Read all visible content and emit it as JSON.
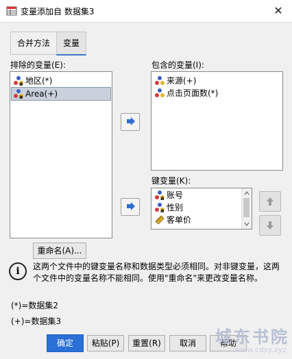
{
  "window": {
    "title": "变量添加自 数据集3",
    "close_glyph": "✕"
  },
  "tabs": [
    {
      "label": "合并方法",
      "active": false
    },
    {
      "label": "变量",
      "active": true
    }
  ],
  "excluded": {
    "label": "排除的变量(E):",
    "items": [
      {
        "label": "地区(*)",
        "icon": "nominal-variable-icon",
        "selected": false
      },
      {
        "label": "Area(+)",
        "icon": "nominal-variable-icon",
        "selected": true
      }
    ]
  },
  "included": {
    "label": "包含的变量(I):",
    "items": [
      {
        "label": "来源(+)",
        "icon": "nominal-variable-icon"
      },
      {
        "label": "点击页面数(*)",
        "icon": "scale-variable-icon"
      }
    ]
  },
  "key": {
    "label": "键变量(K):",
    "items": [
      {
        "label": "账号",
        "icon": "nominal-variable-icon"
      },
      {
        "label": "性别",
        "icon": "nominal-variable-icon"
      },
      {
        "label": "客单价",
        "icon": "scale-variable-icon"
      }
    ]
  },
  "rename_button": "重命名(A)...",
  "info_message": "这两个文件中的键变量名称和数据类型必须相同。对非键变量，这两个文件中的变量名称不能相同。使用\"重命名\"来更改变量名称。",
  "legend": {
    "star": "(*)=数据集2",
    "plus": "(+)=数据集3"
  },
  "buttons": {
    "ok": "确定",
    "paste": "粘贴(P)",
    "reset": "重置(R)",
    "cancel": "取消",
    "help": "帮助"
  },
  "watermark": {
    "main": "城东书院",
    "sub": "www.cdsy.xyz"
  },
  "colors": {
    "primary": "#2a70d6",
    "arrow": "#2f6fd0",
    "selection": "#c9d2dc"
  }
}
